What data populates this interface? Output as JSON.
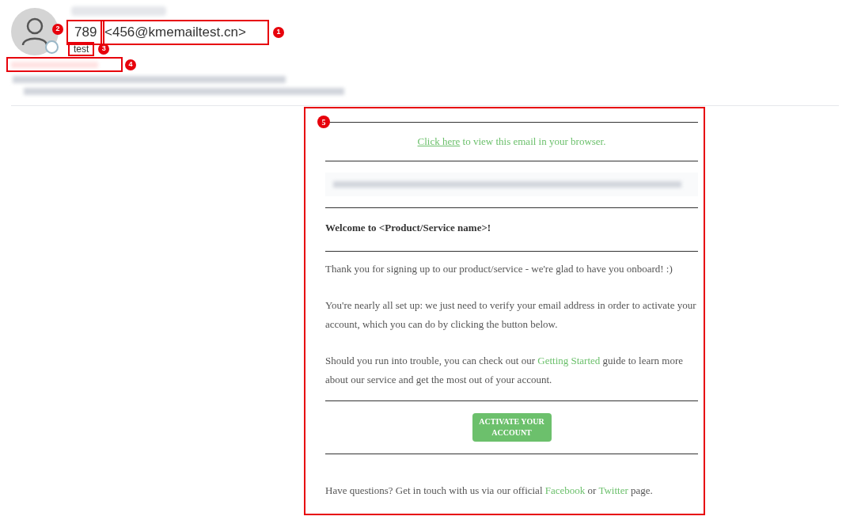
{
  "header": {
    "sender_name": "789",
    "sender_email": "<456@kmemailtest.cn>",
    "recipient": "test",
    "annotations": {
      "email": "1",
      "name": "2",
      "recipient": "3",
      "blurred_line": "4"
    }
  },
  "email_body": {
    "annotation": "5",
    "browser_line": [
      {
        "kind": "link",
        "text": "Click here"
      },
      {
        "kind": "text",
        "text": " to view this email in your browser."
      }
    ],
    "heading": "Welcome to <Product/Service name>!",
    "paragraphs": [
      [
        {
          "kind": "text",
          "text": "Thank you for signing up to our product/service - we're glad to have you onboard! :)"
        }
      ],
      [
        {
          "kind": "text",
          "text": "You're nearly all set up: we just need to verify your email address in order to activate your account, which you can do by clicking the button below."
        }
      ],
      [
        {
          "kind": "text",
          "text": "Should you run into trouble, you can check out our "
        },
        {
          "kind": "link",
          "text": "Getting Started"
        },
        {
          "kind": "text",
          "text": " guide to learn more about our service and get the most out of your account."
        }
      ]
    ],
    "button": "ACTIVATE YOUR ACCOUNT",
    "footer": [
      {
        "kind": "text",
        "text": "Have questions? Get in touch with us via our official "
      },
      {
        "kind": "link",
        "text": "Facebook"
      },
      {
        "kind": "text",
        "text": " or "
      },
      {
        "kind": "link",
        "text": "Twitter"
      },
      {
        "kind": "text",
        "text": " page."
      }
    ]
  }
}
